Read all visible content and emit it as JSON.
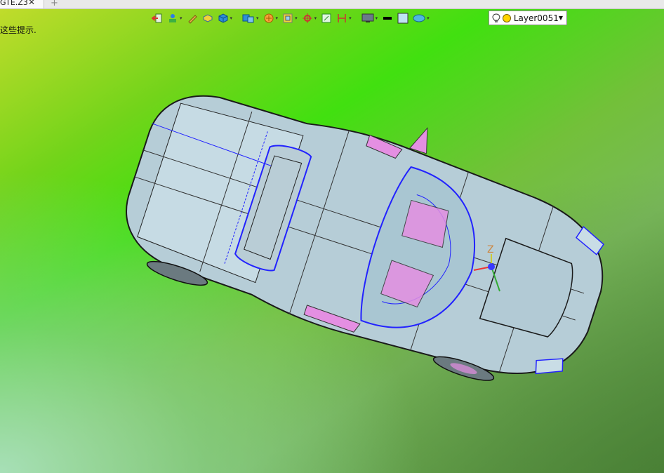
{
  "tab": {
    "label": "GTE.Z3",
    "close": "✕",
    "add": "+"
  },
  "hint": {
    "text": "这些提示."
  },
  "toolbar": {
    "layer_name": "Layer0051",
    "tools": [
      {
        "icon": "exit-icon"
      },
      {
        "icon": "paint-icon"
      },
      {
        "icon": "pencil-icon"
      },
      {
        "icon": "block-icon"
      },
      {
        "icon": "cube-icon"
      },
      {
        "icon": "part-icon"
      },
      {
        "icon": "filter-icon"
      },
      {
        "icon": "view-icon"
      },
      {
        "icon": "snap-icon"
      },
      {
        "icon": "frame-icon"
      },
      {
        "icon": "dimension-icon"
      },
      {
        "icon": "display-icon"
      },
      {
        "icon": "line-color-icon"
      },
      {
        "icon": "face-color-icon"
      },
      {
        "icon": "material-icon"
      },
      {
        "icon": "bulb-icon"
      },
      {
        "icon": "layer-dot-icon"
      }
    ]
  },
  "triad": {
    "z_label": "Z"
  },
  "colors": {
    "body": "#b7cfd8",
    "edge": "#1a1a1a",
    "wire": "#2222ff",
    "pink": "#e48fe2"
  }
}
